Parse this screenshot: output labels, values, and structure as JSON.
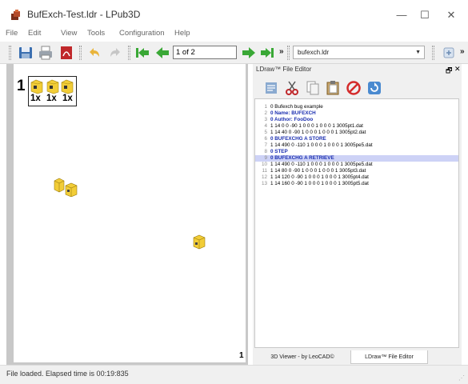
{
  "window": {
    "title": "BufExch-Test.ldr - LPub3D",
    "controls": {
      "minimize": "—",
      "maximize": "☐",
      "close": "✕"
    }
  },
  "menu": {
    "items": [
      "File",
      "Edit",
      "View",
      "Tools",
      "Configuration",
      "Help"
    ]
  },
  "toolbar": {
    "icons": [
      "save-icon",
      "print-icon",
      "pdf-icon",
      "undo-icon",
      "redo-icon",
      "first-page-icon",
      "previous-page-icon",
      "next-page-icon",
      "last-page-icon"
    ],
    "page_value": "1 of 2",
    "more": "»",
    "file_select_value": "bufexch.ldr",
    "more_right": "»"
  },
  "page": {
    "step_number": "1",
    "parts_list": [
      {
        "qty": "1x",
        "color": "#f2cd37"
      },
      {
        "qty": "1x",
        "color": "#f2cd37"
      },
      {
        "qty": "1x",
        "color": "#f2cd37"
      }
    ],
    "page_number": "1"
  },
  "editor": {
    "title": "LDraw™ File Editor",
    "float_glyph": "🗗",
    "close_glyph": "✕",
    "icons": [
      "editor-preferences-icon",
      "cut-icon",
      "copy-icon",
      "paste-icon",
      "delete-icon",
      "redraw-icon"
    ],
    "lines": [
      {
        "n": "1",
        "text": "0 Bufexch bug example",
        "style": "plain"
      },
      {
        "n": "2",
        "text": "0 Name: BUFEXCH",
        "style": "kw"
      },
      {
        "n": "3",
        "text": "0 Author: FooDoo",
        "style": "kw"
      },
      {
        "n": "4",
        "text": "1 14 0 0 -90 1 0 0 0 1 0 0 0 1 3005pt1.dat",
        "style": "plain"
      },
      {
        "n": "5",
        "text": "1 14 40 0 -90 1 0 0 0 1 0 0 0 1 3005pt2.dat",
        "style": "plain"
      },
      {
        "n": "6",
        "text": "0 BUFEXCHG A STORE",
        "style": "kw"
      },
      {
        "n": "7",
        "text": "1 14 490 0 -110 1 0 0 0 1 0 0 0 1 3005pe5.dat",
        "style": "plain"
      },
      {
        "n": "8",
        "text": "0 STEP",
        "style": "kw"
      },
      {
        "n": "9",
        "text": "0 BUFEXCHG A RETRIEVE",
        "style": "hl"
      },
      {
        "n": "10",
        "text": "1 14 490 0 -110 1 0 0 0 1 0 0 0 1 3005pe5.dat",
        "style": "plain"
      },
      {
        "n": "11",
        "text": "1 14 80 0 -90 1 0 0 0 1 0 0 0 1 3005pt3.dat",
        "style": "plain"
      },
      {
        "n": "12",
        "text": "1 14 120 0 -90 1 0 0 0 1 0 0 0 1 3005pt4.dat",
        "style": "plain"
      },
      {
        "n": "13",
        "text": "1 14 160 0 -90 1 0 0 0 1 0 0 0 1 3005pt5.dat",
        "style": "plain"
      }
    ],
    "tabs": [
      {
        "label": "3D Viewer - by LeoCAD©",
        "active": false
      },
      {
        "label": "LDraw™ File Editor",
        "active": true
      }
    ]
  },
  "status": {
    "text": "File loaded. Elapsed time is 00:19:835"
  },
  "colors": {
    "brick_yellow": "#f2cd37",
    "keyword_blue": "#1a2eb0",
    "highlight_line": "#cdd2f6",
    "nav_green": "#3aa836",
    "pdf_red": "#c0282b"
  }
}
